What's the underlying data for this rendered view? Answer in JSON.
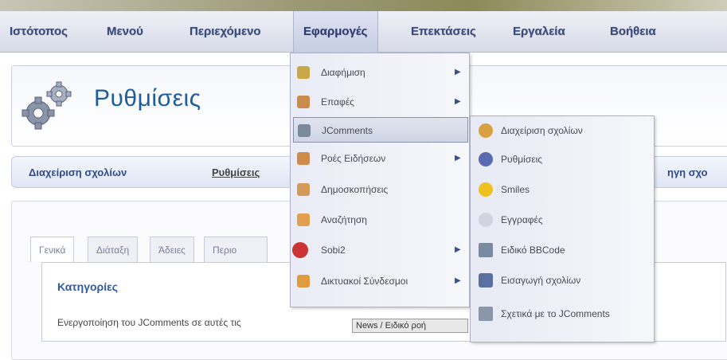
{
  "menubar": {
    "items": [
      "Ιστότοπος",
      "Μενού",
      "Περιεχόμενο",
      "Εφαρμογές",
      "Επεκτάσεις",
      "Εργαλεία",
      "Βοήθεια"
    ]
  },
  "page": {
    "title": "Ρυθμίσεις",
    "gear_icon": "gears-icon"
  },
  "subnav": {
    "items": [
      "Διαχείριση σχολίων",
      "Ρυθμίσεις"
    ],
    "right_partial": "ηγη σχο"
  },
  "tabs": [
    "Γενικά",
    "Διάταξη",
    "Άδειες",
    "Περιο"
  ],
  "section": {
    "title": "Κατηγορίες",
    "text": "Ενεργοποίηση του JComments σε αυτές τις"
  },
  "tooltip": "News / Ειδικό ροή",
  "dropdown": {
    "items": [
      {
        "label": "Διαφήμιση",
        "icon": "banner-icon",
        "submenu": true,
        "color": "#c9a84a"
      },
      {
        "label": "Επαφές",
        "icon": "contacts-icon",
        "submenu": true,
        "color": "#c98a4a"
      },
      {
        "label": "JComments",
        "icon": "jcomments-icon",
        "submenu": false,
        "color": "#7a8a9a"
      },
      {
        "label": "Ροές Ειδήσεων",
        "icon": "newsfeeds-icon",
        "submenu": true,
        "color": "#d08a4a"
      },
      {
        "label": "Δημοσκοπήσεις",
        "icon": "polls-icon",
        "submenu": false,
        "color": "#d49a5a"
      },
      {
        "label": "Αναζήτηση",
        "icon": "search-icon",
        "submenu": false,
        "color": "#e0a050"
      },
      {
        "label": "Sobi2",
        "icon": "sobi2-icon",
        "submenu": true,
        "color": "#cc3333"
      },
      {
        "label": "Δικτυακοί Σύνδεσμοι",
        "icon": "weblinks-icon",
        "submenu": true,
        "color": "#e09a40"
      }
    ]
  },
  "submenu": {
    "items": [
      {
        "label": "Διαχείριση σχολίων",
        "icon": "comments-manage-icon",
        "color": "#d8a040"
      },
      {
        "label": "Ρυθμίσεις",
        "icon": "settings-icon",
        "color": "#5a6ab0"
      },
      {
        "label": "Smiles",
        "icon": "smiley-icon",
        "color": "#f0c020"
      },
      {
        "label": "Εγγραφές",
        "icon": "subscriptions-icon",
        "color": "#d0d4e0"
      },
      {
        "label": "Ειδικό BBCode",
        "icon": "bbcode-icon",
        "color": "#7a8aa0"
      },
      {
        "label": "Εισαγωγή σχολίων",
        "icon": "import-icon",
        "color": "#5a70a0"
      },
      {
        "label": "Σχετικά με το JComments",
        "icon": "about-icon",
        "color": "#8a96aa"
      }
    ]
  }
}
